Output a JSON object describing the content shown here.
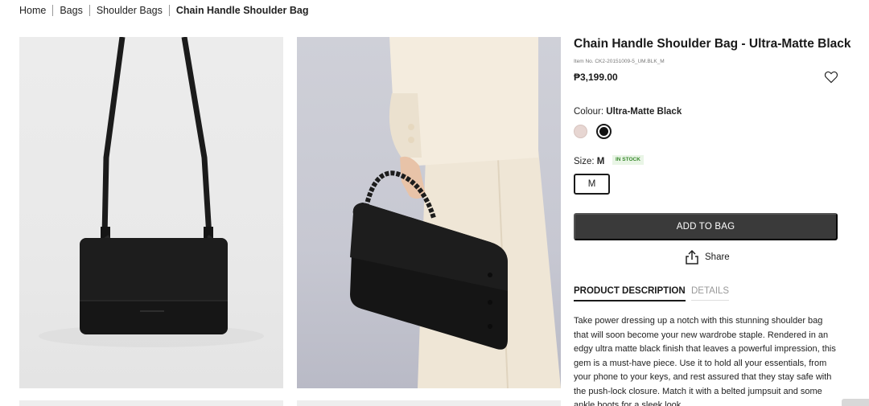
{
  "breadcrumb": [
    "Home",
    "Bags",
    "Shoulder Bags",
    "Chain Handle Shoulder Bag"
  ],
  "product": {
    "title": "Chain Handle Shoulder Bag - Ultra-Matte Black",
    "item_no": "Item No. CK2-20151009-5_UM.BLK_M",
    "price": "₱3,199.00"
  },
  "colour": {
    "label": "Colour:",
    "selected": "Ultra-Matte Black",
    "swatches": [
      "#e7d6d2",
      "#111111"
    ]
  },
  "size": {
    "label": "Size:",
    "selected": "M",
    "stock_badge": "IN STOCK",
    "options": [
      "M"
    ]
  },
  "actions": {
    "add_to_bag": "ADD TO BAG",
    "share": "Share"
  },
  "tabs": {
    "description": "PRODUCT DESCRIPTION",
    "details": "DETAILS"
  },
  "description": "Take power dressing up a notch with this stunning shoulder bag that will soon become your new wardrobe staple. Rendered in an edgy ultra matte black finish that leaves a powerful impression, this gem is a must-have piece. Use it to hold all your essentials, from your phone to your keys, and rest assured that they stay safe with the push-lock closure. Match it with a belted jumpsuit and some ankle boots for a sleek look.",
  "icons": {
    "wishlist": "heart-icon",
    "share": "share-icon"
  }
}
